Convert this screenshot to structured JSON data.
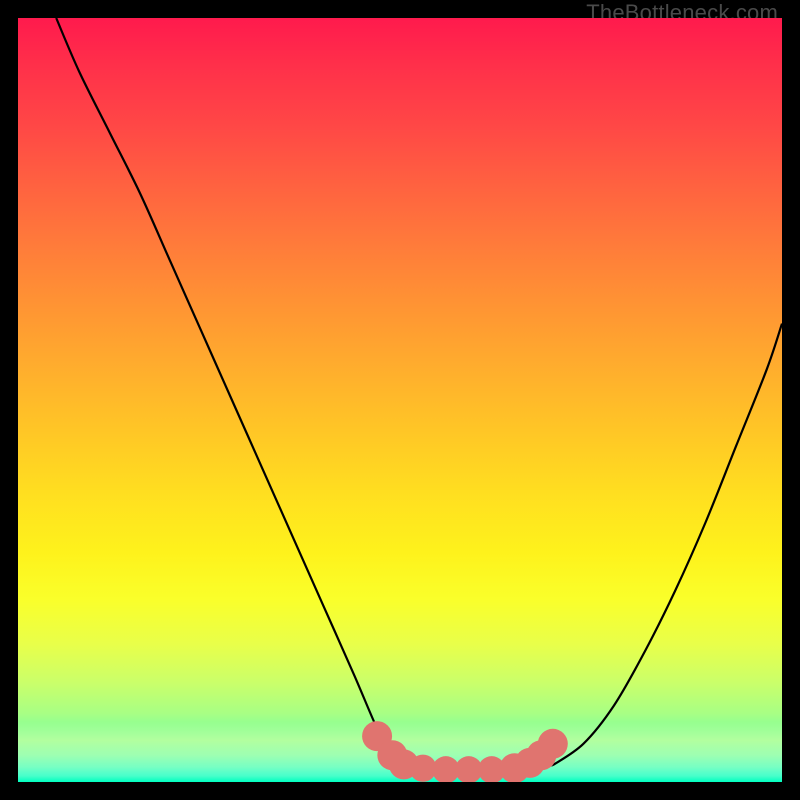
{
  "watermark": "TheBottleneck.com",
  "colors": {
    "background": "#000000",
    "curve": "#000000",
    "marker_fill": "#e0746f",
    "marker_stroke": "#c9544f",
    "gradient_top": "#ff1a4d",
    "gradient_bottom": "#00ffc1"
  },
  "chart_data": {
    "type": "line",
    "title": "",
    "xlabel": "",
    "ylabel": "",
    "xlim": [
      0,
      100
    ],
    "ylim": [
      0,
      100
    ],
    "series": [
      {
        "name": "left-curve",
        "x": [
          5,
          8,
          12,
          16,
          20,
          24,
          28,
          32,
          36,
          40,
          44,
          47,
          49.5
        ],
        "y": [
          100,
          93,
          85,
          77,
          68,
          59,
          50,
          41,
          32,
          23,
          14,
          7,
          2
        ]
      },
      {
        "name": "valley-floor",
        "x": [
          49.5,
          54,
          60,
          66,
          70
        ],
        "y": [
          2,
          1.5,
          1.5,
          1.7,
          2.2
        ]
      },
      {
        "name": "right-curve",
        "x": [
          70,
          74,
          78,
          82,
          86,
          90,
          94,
          98,
          100
        ],
        "y": [
          2.2,
          5,
          10,
          17,
          25,
          34,
          44,
          54,
          60
        ]
      }
    ],
    "markers": {
      "name": "valley-markers",
      "points": [
        {
          "x": 47,
          "y": 6,
          "r": 1.6
        },
        {
          "x": 49,
          "y": 3.5,
          "r": 1.6
        },
        {
          "x": 50.5,
          "y": 2.3,
          "r": 1.6
        },
        {
          "x": 53,
          "y": 1.8,
          "r": 1.4
        },
        {
          "x": 56,
          "y": 1.6,
          "r": 1.4
        },
        {
          "x": 59,
          "y": 1.6,
          "r": 1.4
        },
        {
          "x": 62,
          "y": 1.6,
          "r": 1.4
        },
        {
          "x": 65,
          "y": 1.8,
          "r": 1.6
        },
        {
          "x": 67,
          "y": 2.5,
          "r": 1.6
        },
        {
          "x": 68.5,
          "y": 3.5,
          "r": 1.6
        },
        {
          "x": 70,
          "y": 5,
          "r": 1.6
        }
      ]
    }
  }
}
